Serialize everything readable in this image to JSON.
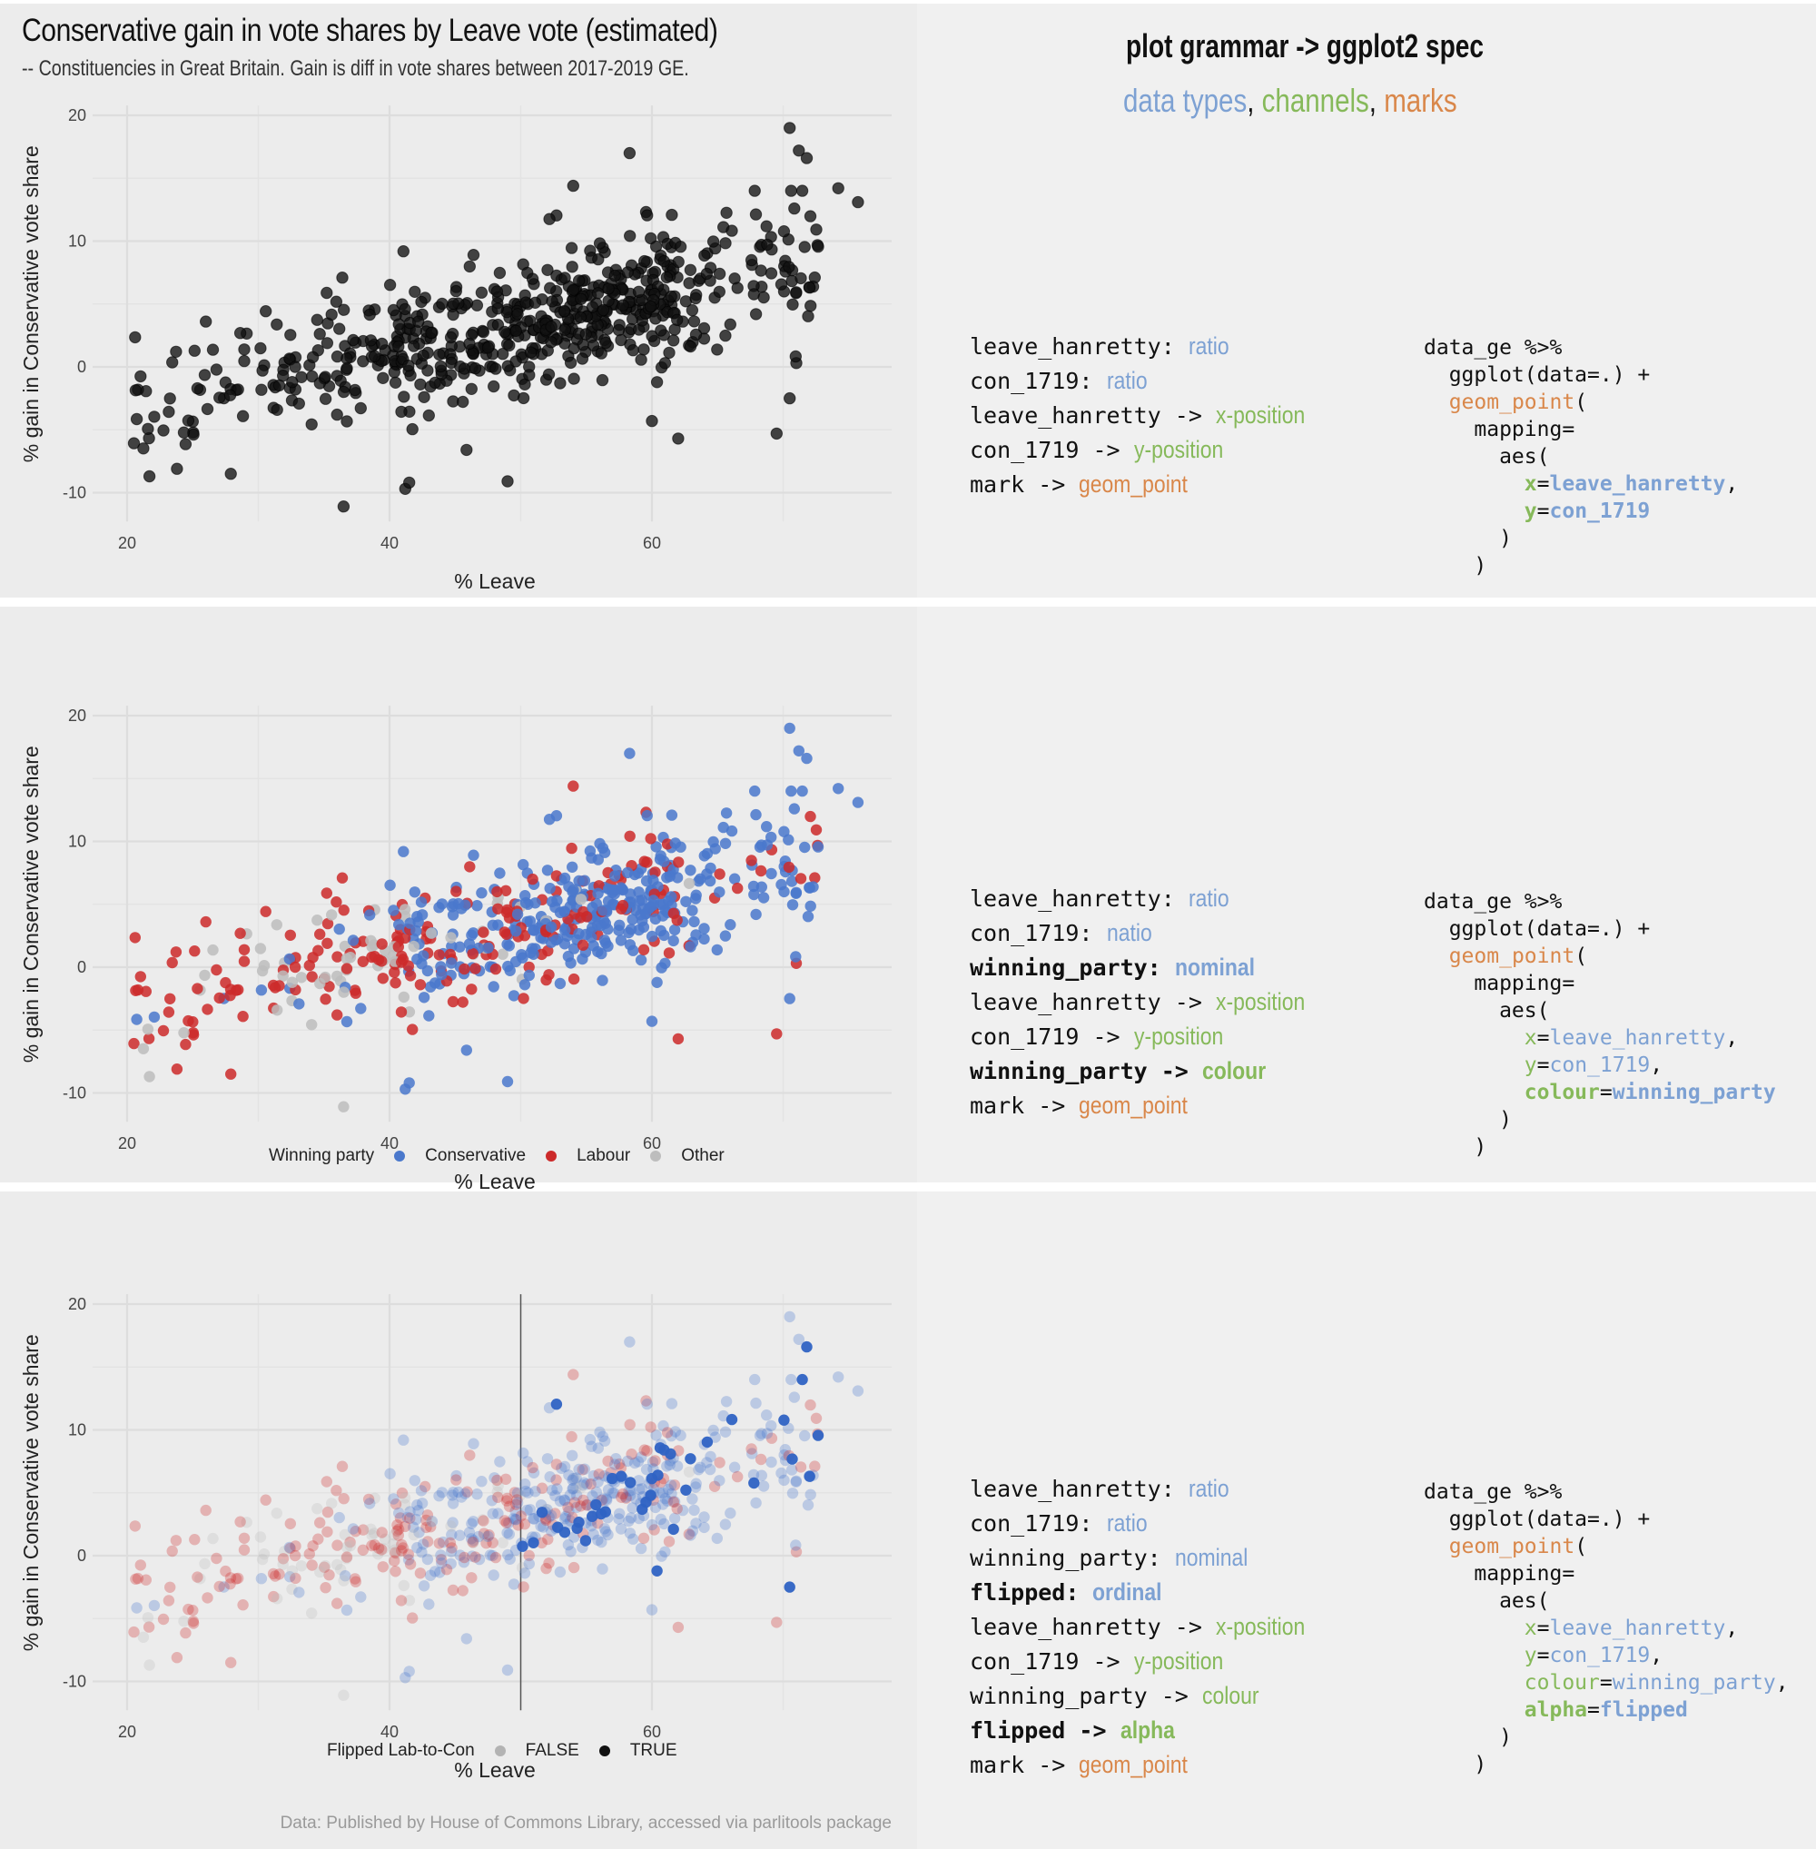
{
  "header": {
    "title": "Conservative gain in vote shares by Leave vote (estimated)",
    "subtitle": "-- Constituencies in Great Britain. Gain is diff in vote shares between 2017-2019 GE.",
    "right_title": "plot grammar -> ggplot2 spec",
    "right_subtitle": [
      {
        "text": "data types",
        "color": "#7da1d3"
      },
      {
        "text": ", ",
        "color": "#111111"
      },
      {
        "text": "channels",
        "color": "#86b95a"
      },
      {
        "text": ", ",
        "color": "#111111"
      },
      {
        "text": "marks",
        "color": "#d9874a"
      }
    ]
  },
  "caption": "Data: Published by House of Commons Library, accessed via parlitools package",
  "colors": {
    "conservative": "#3f72c8",
    "labour": "#cc2a2a",
    "other": "#bdbdbd",
    "black": "#111111",
    "data_type": "#7da1d3",
    "channel": "#86b95a",
    "mark": "#d9874a"
  },
  "panels": [
    {
      "spec_lines": [
        [
          {
            "t": "leave_hanretty:",
            "c": "k"
          },
          {
            "t": "ratio",
            "c": "b",
            "v": 1
          }
        ],
        [
          {
            "t": "con_1719:",
            "c": "k"
          },
          {
            "t": "ratio",
            "c": "b",
            "v": 1
          }
        ],
        [
          {
            "t": "leave_hanretty ->",
            "c": "k"
          },
          {
            "t": "x-position",
            "c": "g",
            "v": 1
          }
        ],
        [
          {
            "t": "con_1719 ->",
            "c": "k"
          },
          {
            "t": "y-position",
            "c": "g",
            "v": 1
          }
        ],
        [
          {
            "t": "mark ->",
            "c": "k"
          },
          {
            "t": "geom_point",
            "c": "o",
            "v": 1
          }
        ]
      ],
      "code_lines": [
        [
          {
            "t": "data_ge %>%",
            "c": "k"
          }
        ],
        [
          {
            "t": "  ggplot(data=.) +",
            "c": "k"
          }
        ],
        [
          {
            "t": "  "
          },
          {
            "t": "geom_point",
            "c": "o"
          },
          {
            "t": "(",
            "c": "k"
          }
        ],
        [
          {
            "t": "    mapping=",
            "c": "k"
          }
        ],
        [
          {
            "t": "      aes(",
            "c": "k"
          }
        ],
        [
          {
            "t": "        "
          },
          {
            "t": "x",
            "c": "g",
            "bold": 1
          },
          {
            "t": "=",
            "c": "k"
          },
          {
            "t": "leave_hanretty",
            "c": "b",
            "bold": 1
          },
          {
            "t": ",",
            "c": "k"
          }
        ],
        [
          {
            "t": "        "
          },
          {
            "t": "y",
            "c": "g",
            "bold": 1
          },
          {
            "t": "=",
            "c": "k"
          },
          {
            "t": "con_1719",
            "c": "b",
            "bold": 1
          }
        ],
        [
          {
            "t": "      )",
            "c": "k"
          }
        ],
        [
          {
            "t": "    )",
            "c": "k"
          }
        ]
      ]
    },
    {
      "spec_lines": [
        [
          {
            "t": "leave_hanretty:",
            "c": "k"
          },
          {
            "t": "ratio",
            "c": "b",
            "v": 1
          }
        ],
        [
          {
            "t": "con_1719:",
            "c": "k"
          },
          {
            "t": "natio",
            "c": "b",
            "v": 1
          }
        ],
        [
          {
            "t": "winning_party:",
            "c": "k",
            "bold": 1
          },
          {
            "t": "nominal",
            "c": "b",
            "v": 1,
            "bold": 1
          }
        ],
        [
          {
            "t": "leave_hanretty ->",
            "c": "k"
          },
          {
            "t": "x-position",
            "c": "g",
            "v": 1
          }
        ],
        [
          {
            "t": "con_1719 ->",
            "c": "k"
          },
          {
            "t": "y-position",
            "c": "g",
            "v": 1
          }
        ],
        [
          {
            "t": "winning_party ->",
            "c": "k",
            "bold": 1
          },
          {
            "t": "colour",
            "c": "g",
            "v": 1,
            "bold": 1
          }
        ],
        [
          {
            "t": "mark ->",
            "c": "k"
          },
          {
            "t": "geom_point",
            "c": "o",
            "v": 1
          }
        ]
      ],
      "code_lines": [
        [
          {
            "t": "data_ge %>%",
            "c": "k"
          }
        ],
        [
          {
            "t": "  ggplot(data=.) +",
            "c": "k"
          }
        ],
        [
          {
            "t": "  "
          },
          {
            "t": "geom_point",
            "c": "o"
          },
          {
            "t": "(",
            "c": "k"
          }
        ],
        [
          {
            "t": "    mapping=",
            "c": "k"
          }
        ],
        [
          {
            "t": "      aes(",
            "c": "k"
          }
        ],
        [
          {
            "t": "        "
          },
          {
            "t": "x",
            "c": "g"
          },
          {
            "t": "=",
            "c": "k"
          },
          {
            "t": "leave_hanretty",
            "c": "b"
          },
          {
            "t": ",",
            "c": "k"
          }
        ],
        [
          {
            "t": "        "
          },
          {
            "t": "y",
            "c": "g"
          },
          {
            "t": "=",
            "c": "k"
          },
          {
            "t": "con_1719",
            "c": "b"
          },
          {
            "t": ",",
            "c": "k"
          }
        ],
        [
          {
            "t": "        "
          },
          {
            "t": "colour",
            "c": "g",
            "bold": 1
          },
          {
            "t": "=",
            "c": "k"
          },
          {
            "t": "winning_party",
            "c": "b",
            "bold": 1
          }
        ],
        [
          {
            "t": "      )",
            "c": "k"
          }
        ],
        [
          {
            "t": "    )",
            "c": "k"
          }
        ]
      ],
      "legend": {
        "title": "Winning party",
        "items": [
          {
            "label": "Conservative",
            "color": "#4a78cc"
          },
          {
            "label": "Labour",
            "color": "#cc2a2a"
          },
          {
            "label": "Other",
            "color": "#bdbdbd"
          }
        ]
      }
    },
    {
      "spec_lines": [
        [
          {
            "t": "leave_hanretty:",
            "c": "k"
          },
          {
            "t": "ratio",
            "c": "b",
            "v": 1
          }
        ],
        [
          {
            "t": "con_1719:",
            "c": "k"
          },
          {
            "t": "ratio",
            "c": "b",
            "v": 1
          }
        ],
        [
          {
            "t": "winning_party:",
            "c": "k"
          },
          {
            "t": "nominal",
            "c": "b",
            "v": 1
          }
        ],
        [
          {
            "t": "flipped:",
            "c": "k",
            "bold": 1
          },
          {
            "t": "ordinal",
            "c": "b",
            "v": 1,
            "bold": 1
          }
        ],
        [
          {
            "t": "leave_hanretty ->",
            "c": "k"
          },
          {
            "t": "x-position",
            "c": "g",
            "v": 1
          }
        ],
        [
          {
            "t": "con_1719 ->",
            "c": "k"
          },
          {
            "t": "y-position",
            "c": "g",
            "v": 1
          }
        ],
        [
          {
            "t": "winning_party ->",
            "c": "k"
          },
          {
            "t": "colour",
            "c": "g",
            "v": 1
          }
        ],
        [
          {
            "t": "flipped ->",
            "c": "k",
            "bold": 1
          },
          {
            "t": "alpha",
            "c": "g",
            "v": 1,
            "bold": 1
          }
        ],
        [
          {
            "t": "mark ->",
            "c": "k"
          },
          {
            "t": "geom_point",
            "c": "o",
            "v": 1
          }
        ]
      ],
      "code_lines": [
        [
          {
            "t": "data_ge %>%",
            "c": "k"
          }
        ],
        [
          {
            "t": "  ggplot(data=.) +",
            "c": "k"
          }
        ],
        [
          {
            "t": "  "
          },
          {
            "t": "geom_point",
            "c": "o"
          },
          {
            "t": "(",
            "c": "k"
          }
        ],
        [
          {
            "t": "    mapping=",
            "c": "k"
          }
        ],
        [
          {
            "t": "      aes(",
            "c": "k"
          }
        ],
        [
          {
            "t": "        "
          },
          {
            "t": "x",
            "c": "g"
          },
          {
            "t": "=",
            "c": "k"
          },
          {
            "t": "leave_hanretty",
            "c": "b"
          },
          {
            "t": ",",
            "c": "k"
          }
        ],
        [
          {
            "t": "        "
          },
          {
            "t": "y",
            "c": "g"
          },
          {
            "t": "=",
            "c": "k"
          },
          {
            "t": "con_1719",
            "c": "b"
          },
          {
            "t": ",",
            "c": "k"
          }
        ],
        [
          {
            "t": "        "
          },
          {
            "t": "colour",
            "c": "g"
          },
          {
            "t": "=",
            "c": "k"
          },
          {
            "t": "winning_party",
            "c": "b"
          },
          {
            "t": ",",
            "c": "k"
          }
        ],
        [
          {
            "t": "        "
          },
          {
            "t": "alpha",
            "c": "g",
            "bold": 1
          },
          {
            "t": "=",
            "c": "k"
          },
          {
            "t": "flipped",
            "c": "b",
            "bold": 1
          }
        ],
        [
          {
            "t": "      )",
            "c": "k"
          }
        ],
        [
          {
            "t": "    )",
            "c": "k"
          }
        ]
      ],
      "legend": {
        "title": "Flipped Lab-to-Con",
        "items": [
          {
            "label": "FALSE",
            "color": "#b3b3b3"
          },
          {
            "label": "TRUE",
            "color": "#111111"
          }
        ]
      }
    }
  ],
  "chart_data": [
    {
      "type": "scatter",
      "title": "Conservative gain in vote shares by Leave vote (estimated)",
      "subtitle": "-- Constituencies in Great Britain. Gain is diff in vote shares between 2017-2019 GE.",
      "xlabel": "% Leave",
      "ylabel": "% gain in Conservative vote share",
      "xlim": [
        17.5,
        76.5
      ],
      "ylim": [
        -12,
        20.5
      ],
      "xticks": [
        20,
        40,
        60
      ],
      "yticks": [
        -10,
        0,
        10,
        20
      ],
      "grid": true,
      "encoding": "black points, alpha 0.75",
      "n_points_approx": 632,
      "trend": "positive: gain rises from about -3 at 20% Leave to about +7 at 70% Leave",
      "notable_points": [
        {
          "x": 70.5,
          "y": 19.0,
          "party": "Conservative",
          "flipped": false
        },
        {
          "x": 71.2,
          "y": 17.2,
          "party": "Conservative",
          "flipped": false
        },
        {
          "x": 71.8,
          "y": 16.6,
          "party": "Conservative",
          "flipped": true
        },
        {
          "x": 58.3,
          "y": 17.0,
          "party": "Conservative",
          "flipped": false
        },
        {
          "x": 54.0,
          "y": 14.4,
          "party": "Labour",
          "flipped": false
        },
        {
          "x": 74.2,
          "y": 14.2,
          "party": "Conservative",
          "flipped": false
        },
        {
          "x": 75.7,
          "y": 13.1,
          "party": "Conservative",
          "flipped": false
        },
        {
          "x": 36.4,
          "y": 7.1,
          "party": "Labour",
          "flipped": false
        },
        {
          "x": 46.4,
          "y": 8.9,
          "party": "Conservative",
          "flipped": false
        },
        {
          "x": 26.0,
          "y": 3.6,
          "party": "Labour",
          "flipped": false
        },
        {
          "x": 36.5,
          "y": -11.1,
          "party": "Other",
          "flipped": false
        },
        {
          "x": 41.2,
          "y": -9.7,
          "party": "Conservative",
          "flipped": false
        },
        {
          "x": 41.5,
          "y": -9.2,
          "party": "Conservative",
          "flipped": false
        },
        {
          "x": 49.0,
          "y": -9.1,
          "party": "Conservative",
          "flipped": false
        },
        {
          "x": 21.7,
          "y": -8.7,
          "party": "Other",
          "flipped": false
        },
        {
          "x": 23.8,
          "y": -8.1,
          "party": "Labour",
          "flipped": false
        },
        {
          "x": 27.9,
          "y": -8.5,
          "party": "Labour",
          "flipped": false
        },
        {
          "x": 70.5,
          "y": -2.5,
          "party": "Conservative",
          "flipped": true
        },
        {
          "x": 69.5,
          "y": -5.3,
          "party": "Labour",
          "flipped": false
        },
        {
          "x": 62.0,
          "y": -5.7,
          "party": "Labour",
          "flipped": false
        },
        {
          "x": 60.0,
          "y": -4.3,
          "party": "Conservative",
          "flipped": false
        },
        {
          "x": 71.0,
          "y": 0.3,
          "party": "Labour",
          "flipped": false
        }
      ]
    },
    {
      "type": "scatter",
      "xlabel": "% Leave",
      "ylabel": "% gain in Conservative vote share",
      "xlim": [
        17.5,
        76.5
      ],
      "ylim": [
        -12,
        20.5
      ],
      "xticks": [
        20,
        40,
        60
      ],
      "yticks": [
        -10,
        0,
        10,
        20
      ],
      "grid": true,
      "encoding": "colour = winning_party",
      "legend": {
        "title": "Winning party",
        "entries": [
          "Conservative",
          "Labour",
          "Other"
        ],
        "position": "bottom"
      }
    },
    {
      "type": "scatter",
      "xlabel": "% Leave",
      "ylabel": "% gain in Conservative vote share",
      "xlim": [
        17.5,
        76.5
      ],
      "ylim": [
        -12,
        20.5
      ],
      "xticks": [
        20,
        40,
        60
      ],
      "yticks": [
        -10,
        0,
        10,
        20
      ],
      "grid": true,
      "encoding": "colour = winning_party, alpha = flipped",
      "reference_line": {
        "orientation": "vertical",
        "x": 50
      },
      "legend": {
        "title": "Flipped Lab-to-Con",
        "entries": [
          "FALSE",
          "TRUE"
        ],
        "position": "bottom"
      },
      "caption": "Data: Published by House of Commons Library, accessed via parlitools package"
    }
  ]
}
